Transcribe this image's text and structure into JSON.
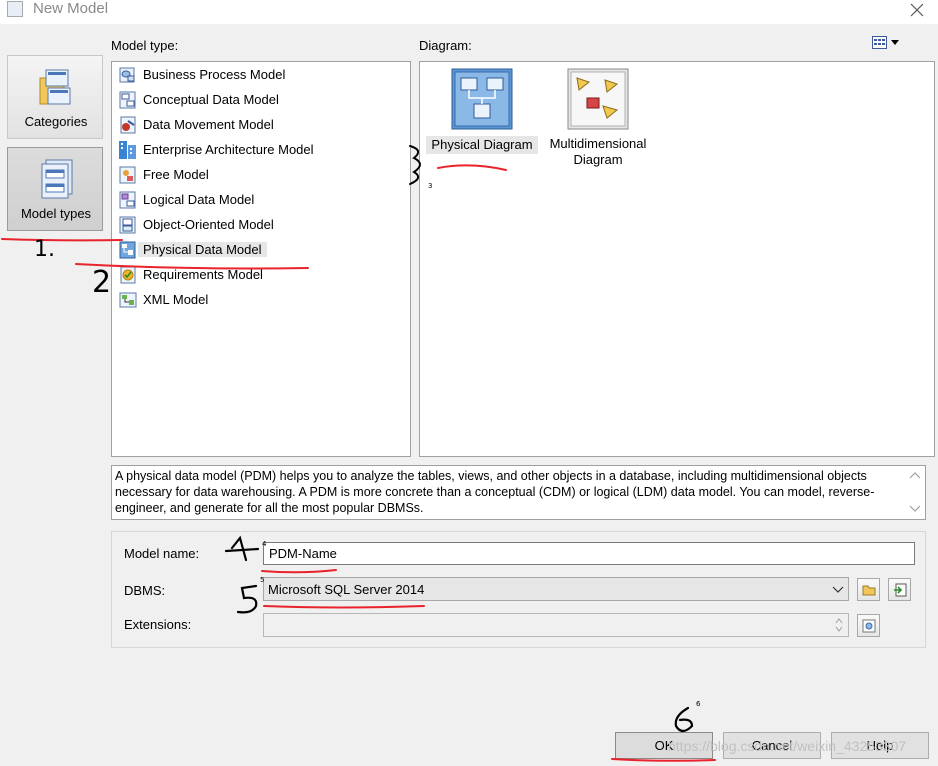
{
  "window": {
    "title": "New Model"
  },
  "categories": [
    {
      "label": "Categories",
      "icon": "folder-stack-icon"
    },
    {
      "label": "Model types",
      "icon": "model-stack-icon",
      "active": true
    }
  ],
  "model_type": {
    "label": "Model type:",
    "items": [
      {
        "label": "Business Process Model",
        "icon": "business-process-icon"
      },
      {
        "label": "Conceptual Data Model",
        "icon": "conceptual-data-icon"
      },
      {
        "label": "Data Movement Model",
        "icon": "data-movement-icon"
      },
      {
        "label": "Enterprise Architecture Model",
        "icon": "enterprise-architecture-icon"
      },
      {
        "label": "Free Model",
        "icon": "free-model-icon"
      },
      {
        "label": "Logical Data Model",
        "icon": "logical-data-icon"
      },
      {
        "label": "Object-Oriented Model",
        "icon": "object-oriented-icon"
      },
      {
        "label": "Physical Data Model",
        "icon": "physical-data-icon",
        "selected": true
      },
      {
        "label": "Requirements Model",
        "icon": "requirements-icon"
      },
      {
        "label": "XML Model",
        "icon": "xml-model-icon"
      }
    ]
  },
  "diagram": {
    "label": "Diagram:",
    "items": [
      {
        "label": "Physical Diagram",
        "icon": "physical-diagram-icon",
        "selected": true
      },
      {
        "label_line1": "Multidimensional",
        "label_line2": "Diagram",
        "icon": "multidimensional-diagram-icon"
      }
    ]
  },
  "description": "A physical data model (PDM) helps you to analyze the tables, views, and other objects in a database, including multidimensional objects necessary for data warehousing. A PDM is more concrete than a conceptual (CDM) or logical (LDM) data model. You can model, reverse-engineer, and generate for all the most popular DBMSs.",
  "form": {
    "model_name_label": "Model name:",
    "model_name_value": "PDM-Name",
    "dbms_label": "DBMS:",
    "dbms_value": "Microsoft SQL Server 2014",
    "extensions_label": "Extensions:",
    "extensions_value": ""
  },
  "buttons": {
    "ok": "OK",
    "cancel": "Cancel",
    "help": "Help"
  },
  "watermark": "https://blog.csdn.net/weixin_43253307",
  "annotations": {
    "n1": "1.",
    "n2": "2",
    "n3": "3",
    "n4": "4",
    "n5": "5",
    "n6": "6"
  },
  "colors": {
    "annotation_red": "#e8232b",
    "selection_gray": "#e6e6e6",
    "window_bg": "#f0f0f0"
  }
}
